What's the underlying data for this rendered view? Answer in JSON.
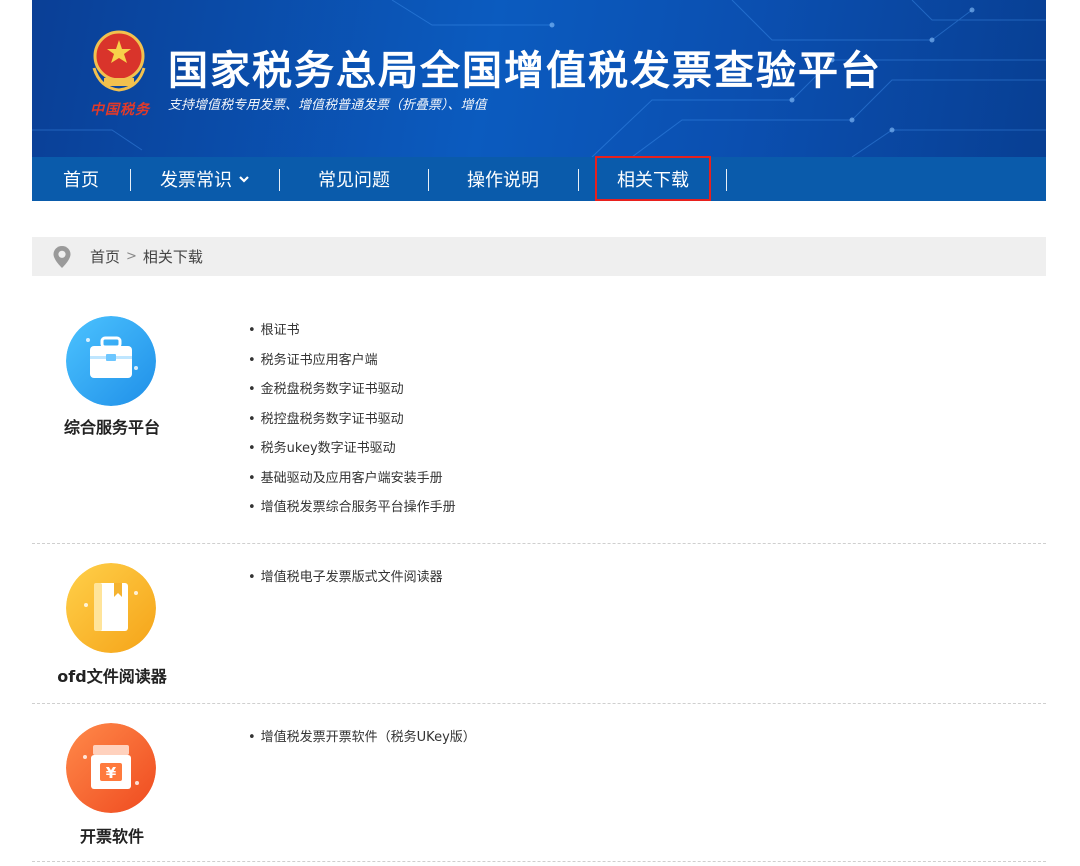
{
  "header": {
    "title": "国家税务总局全国增值税发票查验平台",
    "subtitle": "支持增值税专用发票、增值税普通发票（折叠票）、增值",
    "seal_text": "中国税务"
  },
  "nav": {
    "items": [
      {
        "label": "首页"
      },
      {
        "label": "发票常识"
      },
      {
        "label": "常见问题"
      },
      {
        "label": "操作说明"
      },
      {
        "label": "相关下载"
      }
    ],
    "active": "相关下载"
  },
  "breadcrumb": {
    "home": "首页",
    "separator": ">",
    "current": "相关下载"
  },
  "sections": [
    {
      "title": "综合服务平台",
      "icon": "briefcase-icon",
      "icon_color": "#2aa8f0",
      "links": [
        "根证书",
        "税务证书应用客户端",
        "金税盘税务数字证书驱动",
        "税控盘税务数字证书驱动",
        "税务ukey数字证书驱动",
        "基础驱动及应用客户端安装手册",
        "增值税发票综合服务平台操作手册"
      ]
    },
    {
      "title": "ofd文件阅读器",
      "icon": "book-icon",
      "icon_color": "#f7b321",
      "links": [
        "增值税电子发票版式文件阅读器"
      ]
    },
    {
      "title": "开票软件",
      "icon": "yuan-box-icon",
      "icon_color": "#f4632a",
      "links": [
        "增值税发票开票软件（税务UKey版）"
      ]
    }
  ],
  "colors": {
    "header_bg": "#0b5bbf",
    "nav_bg": "#0a5bab",
    "active_border": "#e8201d",
    "breadcrumb_bg": "#efefef"
  }
}
